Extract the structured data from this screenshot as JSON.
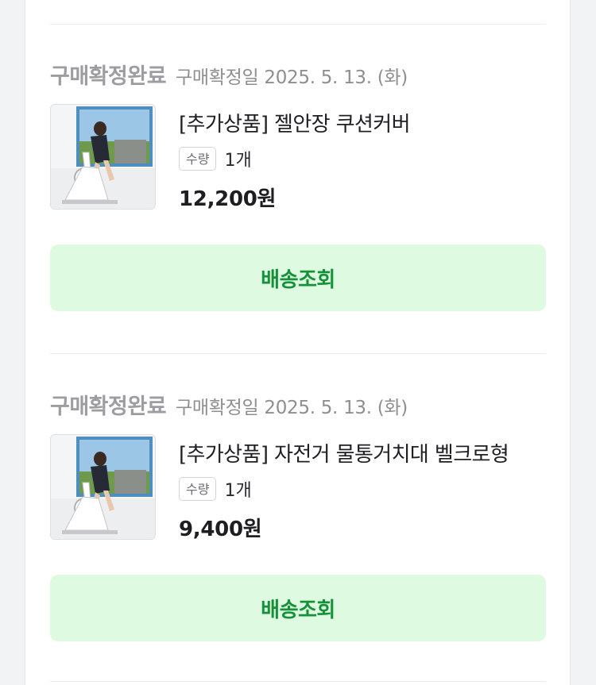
{
  "orders": [
    {
      "status": "구매확정완료",
      "confirm_date": "구매확정일 2025. 5. 13. (화)",
      "product_name": "[추가상품] 젤안장 쿠션커버",
      "qty_label": "수량",
      "qty_value": "1개",
      "price": "12,200원",
      "track_button": "배송조회"
    },
    {
      "status": "구매확정완료",
      "confirm_date": "구매확정일 2025. 5. 13. (화)",
      "product_name": "[추가상품] 자전거 물통거치대 벨크로형",
      "qty_label": "수량",
      "qty_value": "1개",
      "price": "9,400원",
      "track_button": "배송조회"
    }
  ],
  "colors": {
    "status_gray": "#9c9ca1",
    "button_bg": "#defbe2",
    "button_text": "#16913a"
  }
}
